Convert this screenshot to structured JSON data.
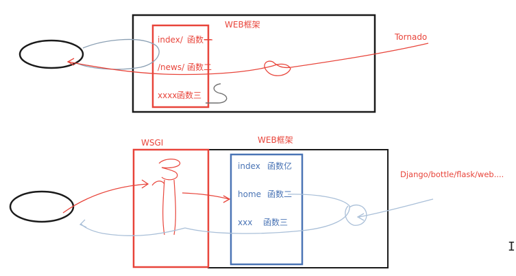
{
  "colors": {
    "red": "#e8443a",
    "blue": "#4a74b5",
    "dark": "#1a1a1a",
    "gray_curve": "#8a9fb3",
    "light_blue_curve": "#a9bfd8"
  },
  "top_diagram": {
    "framework_label": "WEB框架",
    "framework_name": "Tornado",
    "routes": [
      {
        "path": "index/",
        "func": "函数一"
      },
      {
        "path": "/news/",
        "func": "函数二"
      },
      {
        "path": "xxxx",
        "func": "函数三"
      }
    ]
  },
  "bottom_diagram": {
    "wsgi_label": "WSGI",
    "framework_label": "WEB框架",
    "framework_names": "Django/bottle/flask/web....",
    "routes": [
      {
        "path": "index",
        "func": "函数亿"
      },
      {
        "path": "home",
        "func": "函数二"
      },
      {
        "path": "xxx",
        "func": "函数三"
      }
    ]
  },
  "cursor_glyph": "I"
}
